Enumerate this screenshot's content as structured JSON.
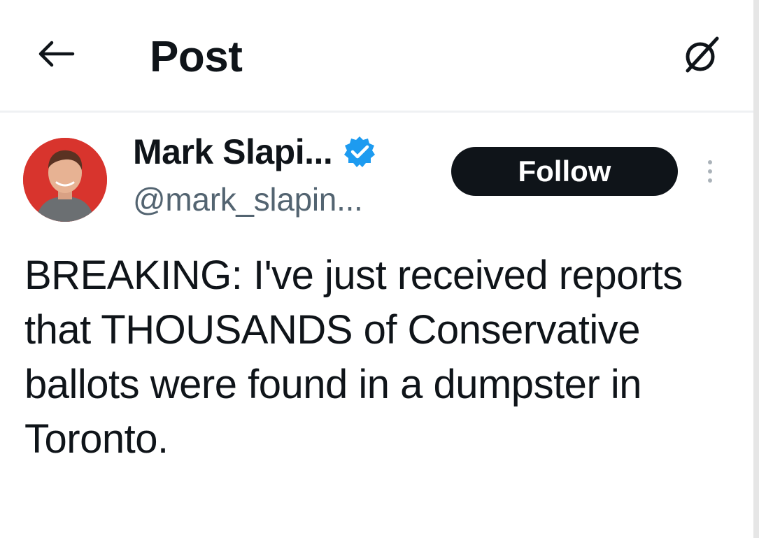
{
  "header": {
    "title": "Post",
    "back_icon": "arrow-left-icon",
    "grok_icon": "grok-icon"
  },
  "author": {
    "display_name": "Mark Slapi...",
    "handle": "@mark_slapin...",
    "verified": true,
    "verified_color": "#1d9bf0",
    "avatar_bg": "#d8342d"
  },
  "actions": {
    "follow_label": "Follow",
    "more_icon": "more-vertical-icon"
  },
  "post": {
    "text": "BREAKING: I've just received reports that THOUSANDS of Conservative ballots were found in a dumpster in Toronto."
  },
  "colors": {
    "text_primary": "#0f1419",
    "text_secondary": "#536471",
    "follow_bg": "#0f1419",
    "follow_text": "#ffffff"
  }
}
